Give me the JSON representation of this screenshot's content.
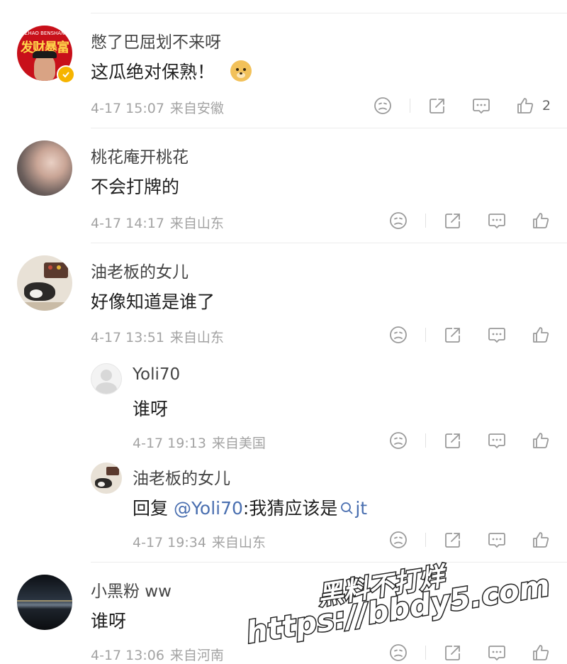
{
  "comments": [
    {
      "author": "憋了巴屈划不来呀",
      "text": "这瓜绝对保熟！",
      "emoji": "🐶",
      "time": "4-17 15:07",
      "location": "来自安徽",
      "likes": "2",
      "avatar_badge_text": "ZHAO BENSHAN",
      "avatar_banner_text": "发财暴富"
    },
    {
      "author": "桃花庵开桃花",
      "text": "不会打牌的",
      "time": "4-17 14:17",
      "location": "来自山东"
    },
    {
      "author": "油老板的女儿",
      "text": "好像知道是谁了",
      "time": "4-17 13:51",
      "location": "来自山东",
      "replies": [
        {
          "author": "Yoli70",
          "text": "谁呀",
          "time": "4-17 19:13",
          "location": "来自美国"
        },
        {
          "author": "油老板的女儿",
          "reply_prefix": "回复 ",
          "mention": "@Yoli70",
          "text": ":我猜应该是",
          "search_term": "jt",
          "time": "4-17 19:34",
          "location": "来自山东"
        }
      ]
    },
    {
      "author": "小黑粉 ww",
      "text": "谁呀",
      "time": "4-17 13:06",
      "location": "来自河南"
    }
  ],
  "watermark": {
    "line1": "黑料不打烊",
    "line2": "https://bbdy5.com"
  },
  "colors": {
    "link": "#4a6fb0",
    "meta": "#a3a3a3",
    "icon": "#9a9a9a"
  }
}
